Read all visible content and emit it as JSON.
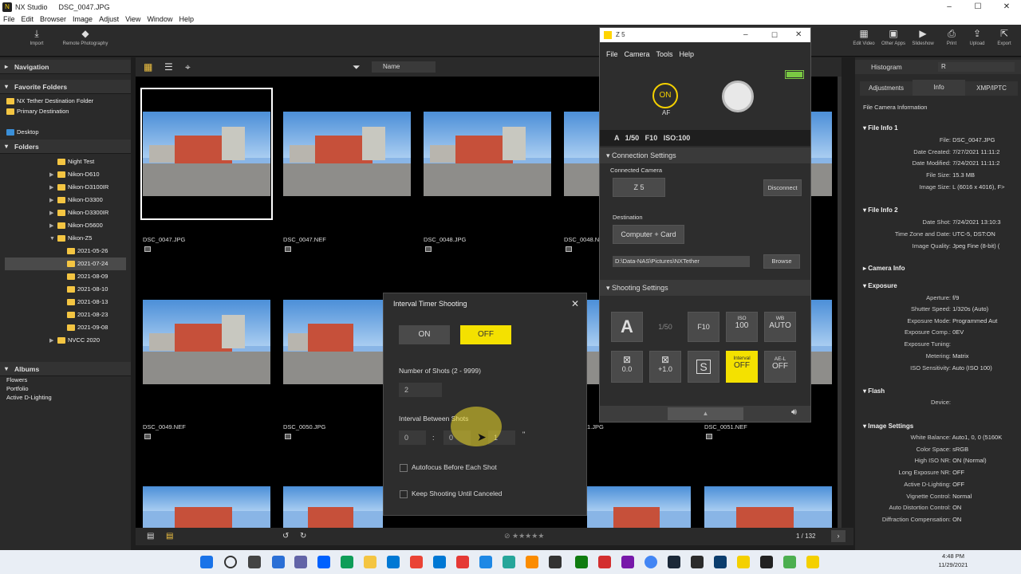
{
  "app": {
    "title_app": "NX Studio",
    "title_file": "DSC_0047.JPG"
  },
  "menu": [
    "File",
    "Edit",
    "Browser",
    "Image",
    "Adjust",
    "View",
    "Window",
    "Help"
  ],
  "toolbar": {
    "import": "Import",
    "remote": "Remote Photography",
    "sort": "Name",
    "right": [
      "Edit Video",
      "Other Apps",
      "Slideshow",
      "Print",
      "Upload",
      "Export"
    ]
  },
  "left": {
    "navigation": "Navigation",
    "favorites": "Favorite Folders",
    "favorite_items": [
      "NX Tether Destination Folder",
      "Primary Destination"
    ],
    "desktop": "Desktop",
    "folders": "Folders",
    "folder_items": [
      "Night Test",
      "Nikon-D610",
      "Nikon-D3100IR",
      "Nikon-D3300",
      "Nikon-D3300IR",
      "Nikon-D5600",
      "Nikon-Z5",
      "2021-05-26",
      "2021-07-24",
      "2021-08-09",
      "2021-08-10",
      "2021-08-13",
      "2021-08-23",
      "2021-09-08",
      "NVCC 2020"
    ],
    "albums": "Albums",
    "album_items": [
      "Flowers",
      "Portfolio",
      "Active D-Lighting"
    ]
  },
  "grid": {
    "row1": [
      "DSC_0047.JPG",
      "DSC_0047.NEF",
      "DSC_0048.JPG",
      "DSC_0048.NEF"
    ],
    "row2": [
      "DSC_0049.NEF",
      "DSC_0050.JPG",
      "1.JPG",
      "DSC_0051.NEF"
    ],
    "page": "1 / 132"
  },
  "right": {
    "histogram": "Histogram",
    "channel": "R",
    "tabs": [
      "Adjustments",
      "Info",
      "XMP/IPTC"
    ],
    "file_cam_info": "File  Camera Information",
    "file_info1": "File Info 1",
    "fi1": [
      [
        "File:",
        "DSC_0047.JPG"
      ],
      [
        "Date Created:",
        "7/27/2021 11:11:2"
      ],
      [
        "Date Modified:",
        "7/24/2021 11:11:2"
      ],
      [
        "File Size:",
        "15.3 MB"
      ],
      [
        "Image Size:",
        "L (6016 x 4016), F>"
      ]
    ],
    "file_info2": "File Info 2",
    "fi2": [
      [
        "Date Shot:",
        "7/24/2021 13:10:3"
      ],
      [
        "Time Zone and Date:",
        "UTC-5, DST:ON"
      ],
      [
        "Image Quality:",
        "Jpeg Fine (8-bit) ("
      ]
    ],
    "camera_info": "Camera Info",
    "exposure": "Exposure",
    "exp": [
      [
        "Aperture:",
        "f/9"
      ],
      [
        "Shutter Speed:",
        "1/320s (Auto)"
      ],
      [
        "Exposure Mode:",
        "Programmed Aut"
      ],
      [
        "Exposure Comp.:",
        "0EV"
      ],
      [
        "Exposure Tuning:",
        ""
      ],
      [
        "Metering:",
        "Matrix"
      ],
      [
        "ISO Sensitivity:",
        "Auto (ISO 100)"
      ]
    ],
    "flash": "Flash",
    "flash_rows": [
      [
        "Device:",
        ""
      ]
    ],
    "image_settings": "Image Settings",
    "img": [
      [
        "White Balance:",
        "Auto1, 0, 0 (5160K"
      ],
      [
        "Color Space:",
        "sRGB"
      ],
      [
        "High ISO NR:",
        "ON (Normal)"
      ],
      [
        "Long Exposure NR:",
        "OFF"
      ],
      [
        "Active D-Lighting:",
        "OFF"
      ],
      [
        "Vignette Control:",
        "Normal"
      ],
      [
        "Auto Distortion Control:",
        "ON"
      ],
      [
        "Diffraction Compensation:",
        "ON"
      ]
    ]
  },
  "z5": {
    "title": "Z 5",
    "menu": [
      "File",
      "Camera",
      "Tools",
      "Help"
    ],
    "af_on": "ON",
    "af": "AF",
    "status": "A   1/50   F10   ISO:100",
    "connection_settings": "Connection Settings",
    "connected_camera": "Connected Camera",
    "camera": "Z 5",
    "disconnect": "Disconnect",
    "destination": "Destination",
    "dest_mode": "Computer + Card",
    "dest_path": "D:\\Data-NAS\\Pictures\\NXTether",
    "browse": "Browse",
    "shooting_settings": "Shooting Settings",
    "mode": "A",
    "shutter": "1/50",
    "aperture": "F10",
    "iso_lbl": "ISO",
    "iso_val": "100",
    "wb_lbl": "WB",
    "wb_val": "AUTO",
    "exp_comp": "0.0",
    "flash_comp": "+1.0",
    "s_icon": "S",
    "interval_lbl": "Interval",
    "interval_val": "OFF",
    "ael_lbl": "AE-L",
    "ael_val": "OFF"
  },
  "dialog": {
    "title": "Interval Timer Shooting",
    "on": "ON",
    "off": "OFF",
    "num_label": "Number of Shots (2 - 9999)",
    "num_value": "2",
    "interval_label": "Interval Between Shots",
    "h": "0",
    "m": "0",
    "s": "1",
    "sep": ":",
    "sec_mark": "\"",
    "autofocus": "Autofocus Before Each Shot",
    "keep": "Keep Shooting Until Canceled"
  },
  "taskbar": {
    "time": "4:48 PM",
    "date": "11/29/2021"
  }
}
